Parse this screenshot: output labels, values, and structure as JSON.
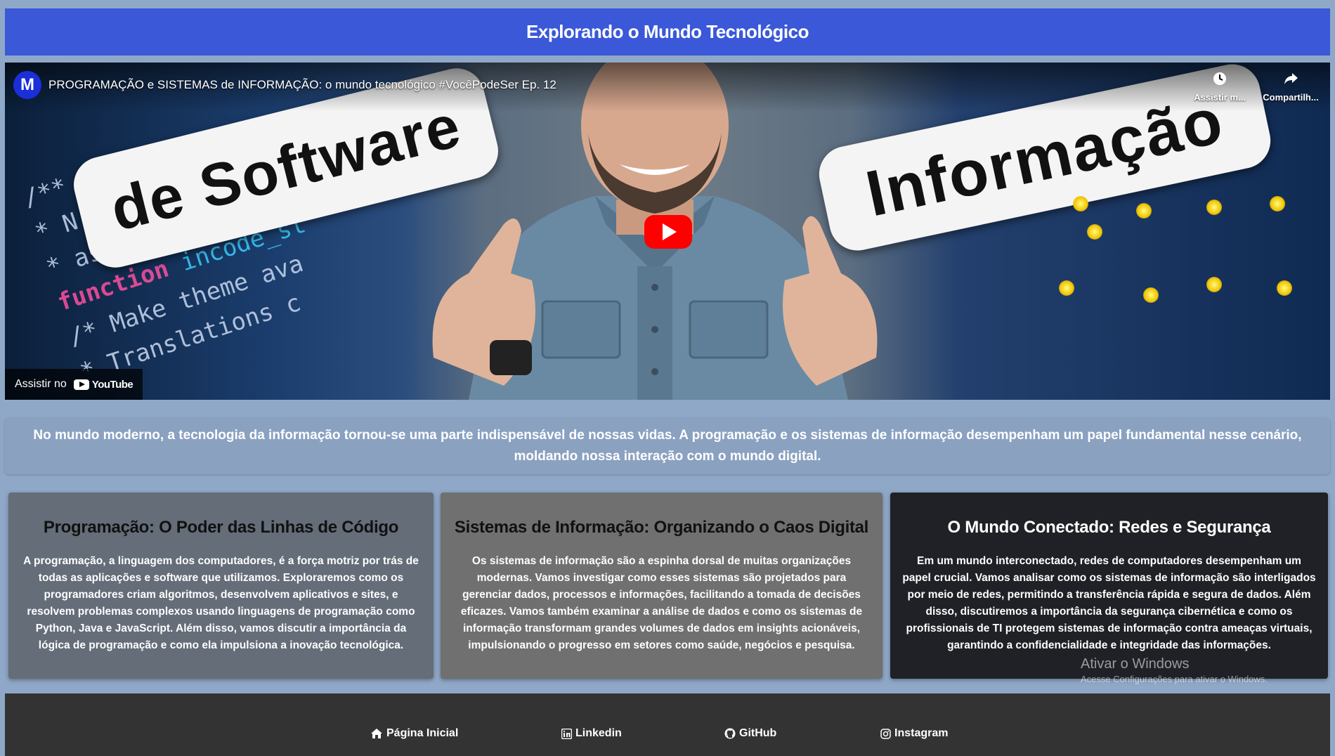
{
  "header": {
    "title": "Explorando o Mundo Tecnológico"
  },
  "video": {
    "channel_initial": "M",
    "title": "PROGRAMAÇÃO e SISTEMAS de INFORMAÇÃO: o mundo tecnológico #VocêPodeSer Ep. 12",
    "watch_later_label": "Assistir m...",
    "share_label": "Compartilh...",
    "watch_on_label": "Assistir no",
    "youtube_label": "YouTube",
    "thumb_left_text": "de Software",
    "thumb_right_text": "Informação",
    "icons": {
      "watch_later": "clock-icon",
      "share": "share-icon",
      "play": "play-icon"
    }
  },
  "intro": {
    "text": "No mundo moderno, a tecnologia da informação tornou-se uma parte indispensável de nossas vidas. A programação e os sistemas de informação desempenham um papel fundamental nesse cenário, moldando nossa interação com o mundo digital."
  },
  "cards": [
    {
      "title": "Programação: O Poder das Linhas de Código",
      "text": "A programação, a linguagem dos computadores, é a força motriz por trás de todas as aplicações e software que utilizamos. Exploraremos como os programadores criam algoritmos, desenvolvem aplicativos e sites, e resolvem problemas complexos usando linguagens de programação como Python, Java e JavaScript. Além disso, vamos discutir a importância da lógica de programação e como ela impulsiona a inovação tecnológica."
    },
    {
      "title": "Sistemas de Informação: Organizando o Caos Digital",
      "text": "Os sistemas de informação são a espinha dorsal de muitas organizações modernas. Vamos investigar como esses sistemas são projetados para gerenciar dados, processos e informações, facilitando a tomada de decisões eficazes. Vamos também examinar a análise de dados e como os sistemas de informação transformam grandes volumes de dados em insights acionáveis, impulsionando o progresso em setores como saúde, negócios e pesquisa."
    },
    {
      "title": "O Mundo Conectado: Redes e Segurança",
      "text": "Em um mundo interconectado, redes de computadores desempenham um papel crucial. Vamos analisar como os sistemas de informação são interligados por meio de redes, permitindo a transferência rápida e segura de dados. Além disso, discutiremos a importância da segurança cibernética e como os profissionais de TI protegem sistemas de informação contra ameaças virtuais, garantindo a confidencialidade e integridade das informações."
    }
  ],
  "windows_watermark": {
    "line1": "Ativar o Windows",
    "line2": "Acesse Configurações para ativar o Windows."
  },
  "footer": {
    "links": [
      {
        "label": "Página Inicial",
        "icon": "home-icon"
      },
      {
        "label": "Linkedin",
        "icon": "linkedin-icon"
      },
      {
        "label": "GitHub",
        "icon": "github-icon"
      },
      {
        "label": "Instagram",
        "icon": "instagram-icon"
      }
    ]
  },
  "colors": {
    "page_bg": "#8fa8c8",
    "header_bg": "#3a58d8",
    "footer_bg": "#333333",
    "card1_bg": "#646d78",
    "card2_bg": "#707070",
    "card3_bg": "#1f2126",
    "youtube_red": "#ff0000"
  }
}
